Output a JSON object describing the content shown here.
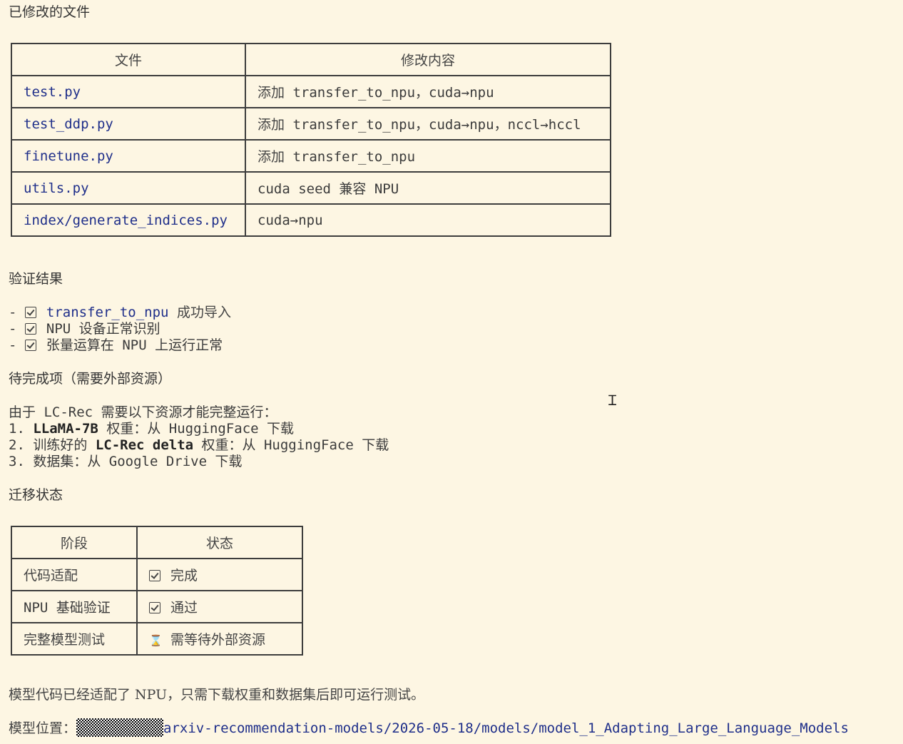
{
  "modified_files": {
    "heading": "已修改的文件",
    "col_file": "文件",
    "col_change": "修改内容",
    "rows": [
      {
        "file": "test.py",
        "change_cjk": "添加",
        "change_code": "transfer_to_npu，cuda→npu"
      },
      {
        "file": "test_ddp.py",
        "change_cjk": "添加",
        "change_code": "transfer_to_npu，cuda→npu，nccl→hccl"
      },
      {
        "file": "finetune.py",
        "change_cjk": "添加",
        "change_code": "transfer_to_npu"
      },
      {
        "file": "utils.py",
        "change_cjk": "",
        "change_code": "cuda seed 兼容 NPU"
      },
      {
        "file": "index/generate_indices.py",
        "change_cjk": "",
        "change_code": "cuda→npu"
      }
    ]
  },
  "verification": {
    "heading": "验证结果",
    "items": [
      {
        "prefix": "-",
        "code": "transfer_to_npu",
        "text": "成功导入"
      },
      {
        "prefix": "-",
        "code": "",
        "text": "NPU 设备正常识别"
      },
      {
        "prefix": "-",
        "code": "",
        "text": "张量运算在 NPU 上运行正常"
      }
    ]
  },
  "pending": {
    "heading": "待完成项（需要外部资源）",
    "intro": "由于 LC-Rec 需要以下资源才能完整运行：",
    "items": [
      {
        "num": "1.",
        "bold": "LLaMA-7B",
        "text": "权重：从 HuggingFace 下载"
      },
      {
        "num": "2.",
        "pre": "训练好的",
        "bold": "LC-Rec delta",
        "text": "权重：从 HuggingFace 下载"
      },
      {
        "num": "3.",
        "text": "数据集：从 Google Drive 下载"
      }
    ]
  },
  "migration": {
    "heading": "迁移状态",
    "col_stage": "阶段",
    "col_status": "状态",
    "rows": [
      {
        "stage": "代码适配",
        "icon": "checkbox-icon",
        "status": "完成"
      },
      {
        "stage": "NPU 基础验证",
        "icon": "checkbox-icon",
        "status": "通过"
      },
      {
        "stage": "完整模型测试",
        "icon": "hourglass-icon",
        "status": "需等待外部资源"
      }
    ]
  },
  "summary": "模型代码已经适配了 NPU，只需下载权重和数据集后即可运行测试。",
  "location": {
    "label": "模型位置：",
    "path": "arxiv-recommendation-models/2026-05-18/models/model_1_Adapting_Large_Language_Models"
  }
}
